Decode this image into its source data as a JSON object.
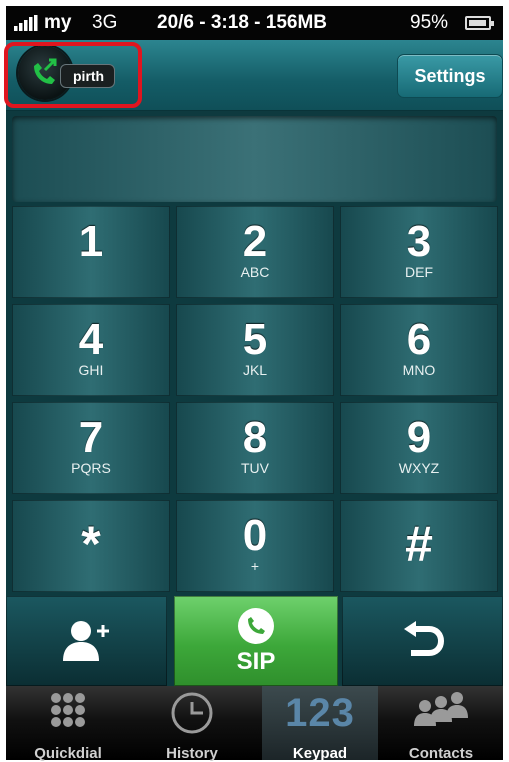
{
  "status_bar": {
    "carrier": "my",
    "network": "3G",
    "info": "20/6 - 3:18 - 156MB",
    "battery": "95%",
    "battery_level": 0.95
  },
  "header": {
    "account_name": "pirth",
    "settings_label": "Settings"
  },
  "display": {
    "number": ""
  },
  "keypad": {
    "keys": [
      {
        "digit": "1",
        "letters": ""
      },
      {
        "digit": "2",
        "letters": "ABC"
      },
      {
        "digit": "3",
        "letters": "DEF"
      },
      {
        "digit": "4",
        "letters": "GHI"
      },
      {
        "digit": "5",
        "letters": "JKL"
      },
      {
        "digit": "6",
        "letters": "MNO"
      },
      {
        "digit": "7",
        "letters": "PQRS"
      },
      {
        "digit": "8",
        "letters": "TUV"
      },
      {
        "digit": "9",
        "letters": "WXYZ"
      },
      {
        "digit": "*",
        "letters": ""
      },
      {
        "digit": "0",
        "letters": "+"
      },
      {
        "digit": "#",
        "letters": ""
      }
    ]
  },
  "actions": {
    "call_label": "SIP",
    "add_contact_icon": "add-contact-icon",
    "backspace_icon": "backspace-icon"
  },
  "tabs": [
    {
      "label": "Quickdial",
      "icon": "grid-icon"
    },
    {
      "label": "History",
      "icon": "clock-icon"
    },
    {
      "label": "Keypad",
      "icon": "123",
      "active": true
    },
    {
      "label": "Contacts",
      "icon": "contacts-icon"
    }
  ],
  "colors": {
    "accent": "#1e6f79",
    "call_green": "#4cb84a",
    "highlight_red": "#e0151f"
  }
}
